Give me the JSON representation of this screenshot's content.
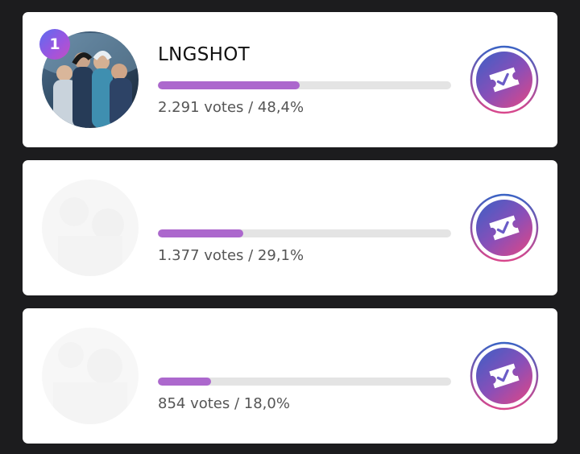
{
  "poll": {
    "entries": [
      {
        "rank": "1",
        "name": "LNGSHOT",
        "votes_text": "2.291 votes / 48,4%",
        "percent": 48.4,
        "icon": "ticket-check-icon"
      },
      {
        "rank": "",
        "name": "",
        "votes_text": "1.377 votes / 29,1%",
        "percent": 29.1,
        "icon": "ticket-check-icon"
      },
      {
        "rank": "",
        "name": "",
        "votes_text": "854 votes / 18,0%",
        "percent": 18.0,
        "icon": "ticket-check-icon"
      }
    ],
    "colors": {
      "bar_fill": "#ac68cd",
      "bar_track": "#e4e4e4",
      "badge_gradient_start": "#5b6df0",
      "badge_gradient_end": "#c34fc4",
      "icon_gradient_start": "#3b63c4",
      "icon_gradient_end": "#d8478c"
    }
  }
}
